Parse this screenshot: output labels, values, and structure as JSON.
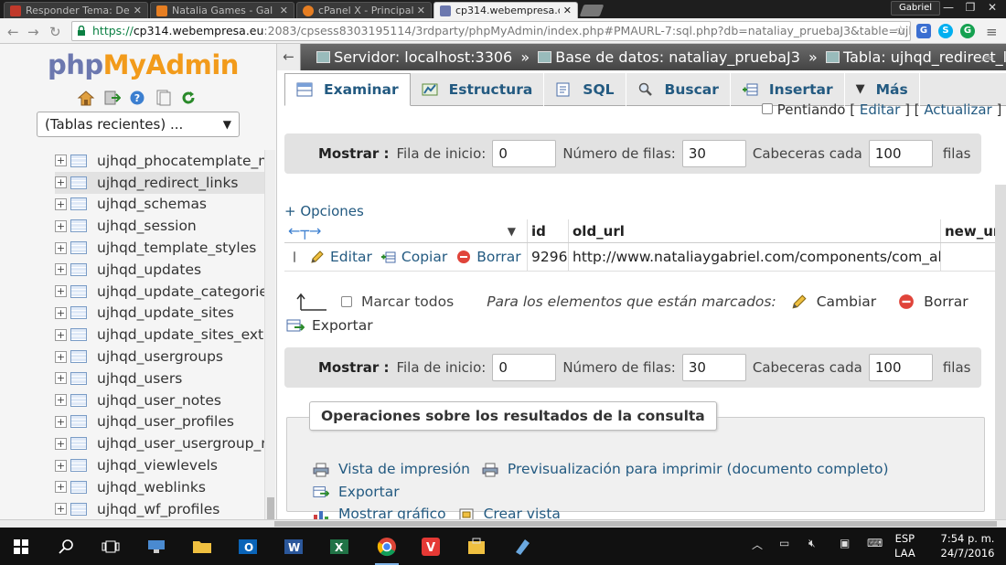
{
  "browser": {
    "tabs": [
      {
        "label": "Responder Tema: De",
        "color": "#c0392b"
      },
      {
        "label": "Natalia Games - Gal",
        "color": "#e67e22"
      },
      {
        "label": "cPanel X - Principal",
        "color": "#e67e22"
      },
      {
        "label": "cp314.webempresa.c",
        "color": "#6c78af"
      }
    ],
    "user": "Gabriel",
    "url": {
      "protocol": "https://",
      "host": "cp314.webempresa.eu",
      "path": ":2083/cpsess8303195114/3rdparty/phpMyAdmin/index.php#PMAURL-7:sql.php?db=nataliay_pruebaJ3&table=ujhqd_redire"
    }
  },
  "sidebar": {
    "logo_php": "php",
    "logo_myadmin": "MyAdmin",
    "recent_tables": "(Tablas recientes) ...",
    "tables": [
      "ujhqd_phocatemplate_me",
      "ujhqd_redirect_links",
      "ujhqd_schemas",
      "ujhqd_session",
      "ujhqd_template_styles",
      "ujhqd_updates",
      "ujhqd_update_categories",
      "ujhqd_update_sites",
      "ujhqd_update_sites_exte",
      "ujhqd_usergroups",
      "ujhqd_users",
      "ujhqd_user_notes",
      "ujhqd_user_profiles",
      "ujhqd_user_usergroup_m",
      "ujhqd_viewlevels",
      "ujhqd_weblinks",
      "ujhqd_wf_profiles"
    ],
    "selected_index": 1
  },
  "breadcrumb": {
    "server": "Servidor: localhost:3306",
    "database": "Base de datos: nataliay_pruebaJ3",
    "table": "Tabla: ujhqd_redirect_links",
    "separator": "»"
  },
  "menu": {
    "tabs": [
      "Examinar",
      "Estructura",
      "SQL",
      "Buscar",
      "Insertar",
      "Más"
    ],
    "active": 0
  },
  "partial_top": {
    "text": "Pentiando",
    "edit": "Editar",
    "refresh": "Actualizar"
  },
  "navigation": {
    "show_label": "Mostrar :",
    "start_row_label": "Fila de inicio:",
    "start_row": "0",
    "num_rows_label": "Número de filas:",
    "num_rows": "30",
    "headers_label": "Cabeceras cada",
    "headers_every": "100",
    "rows_suffix": "filas"
  },
  "options_link": "+ Opciones",
  "results": {
    "columns": [
      "id",
      "old_url",
      "new_ur"
    ],
    "rows": [
      {
        "id": "9296",
        "old_url": "http://www.nataliaygabriel.com/components/com_akee...",
        "new_url": ""
      }
    ],
    "actions": {
      "edit": "Editar",
      "copy": "Copiar",
      "delete": "Borrar"
    }
  },
  "bulk": {
    "check_all": "Marcar todos",
    "selected_text": "Para los elementos que están marcados:",
    "change": "Cambiar",
    "delete": "Borrar",
    "export": "Exportar"
  },
  "operations": {
    "legend": "Operaciones sobre los resultados de la consulta",
    "print_view": "Vista de impresión",
    "print_preview": "Previsualización para imprimir (documento completo)",
    "export": "Exportar",
    "show_chart": "Mostrar gráfico",
    "create_view": "Crear vista"
  },
  "taskbar": {
    "lang_line1": "ESP",
    "lang_line2": "LAA",
    "time": "7:54 p. m.",
    "date": "24/7/2016"
  },
  "colors": {
    "link": "#235a81",
    "logo_php": "#6c78af",
    "logo_myadmin": "#f29b1b"
  }
}
